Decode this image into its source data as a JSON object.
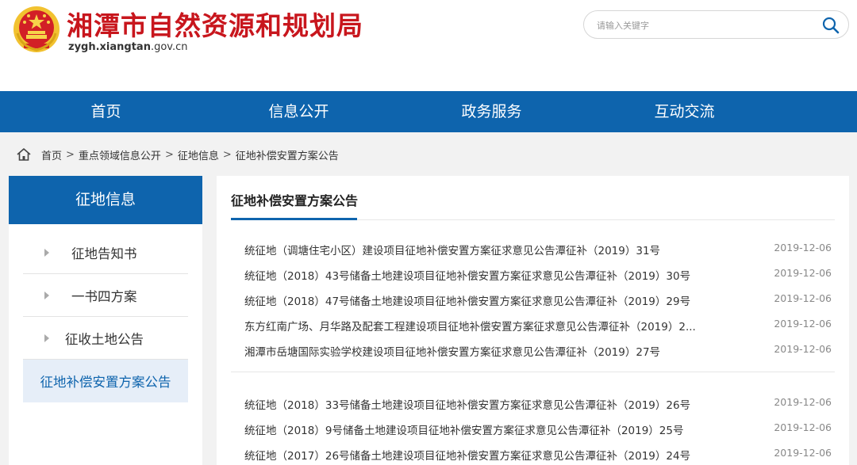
{
  "header": {
    "title": "湘潭市自然资源和规划局",
    "domain_bold": "zygh.xiangtan",
    "domain_rest": ".gov.cn",
    "search_placeholder": "请输入关键字"
  },
  "nav": {
    "items": [
      "首页",
      "信息公开",
      "政务服务",
      "互动交流"
    ]
  },
  "breadcrumb": {
    "items": [
      "首页",
      "重点领域信息公开",
      "征地信息",
      "征地补偿安置方案公告"
    ],
    "separator": ">"
  },
  "sidebar": {
    "heading": "征地信息",
    "items": [
      "征地告知书",
      "一书四方案",
      "征收土地公告",
      "征地补偿安置方案公告"
    ]
  },
  "main": {
    "title": "征地补偿安置方案公告",
    "rows": [
      {
        "title": "统征地（调塘住宅小区）建设项目征地补偿安置方案征求意见公告潭征补（2019）31号",
        "date": "2019-12-06"
      },
      {
        "title": "统征地（2018）43号储备土地建设项目征地补偿安置方案征求意见公告潭征补（2019）30号",
        "date": "2019-12-06"
      },
      {
        "title": "统征地（2018）47号储备土地建设项目征地补偿安置方案征求意见公告潭征补（2019）29号",
        "date": "2019-12-06"
      },
      {
        "title": "东方红南广场、月华路及配套工程建设项目征地补偿安置方案征求意见公告潭征补（2019）2...",
        "date": "2019-12-06"
      },
      {
        "title": "湘潭市岳塘国际实验学校建设项目征地补偿安置方案征求意见公告潭征补（2019）27号",
        "date": "2019-12-06"
      },
      {
        "title": "统征地（2018）33号储备土地建设项目征地补偿安置方案征求意见公告潭征补（2019）26号",
        "date": "2019-12-06"
      },
      {
        "title": "统征地（2018）9号储备土地建设项目征地补偿安置方案征求意见公告潭征补（2019）25号",
        "date": "2019-12-06"
      },
      {
        "title": "统征地（2017）26号储备土地建设项目征地补偿安置方案征求意见公告潭征补（2019）24号",
        "date": "2019-12-06"
      }
    ]
  },
  "colors": {
    "brand_blue": "#0e64ad",
    "title_red": "#c8161d",
    "emblem_gold": "#f2c230"
  }
}
